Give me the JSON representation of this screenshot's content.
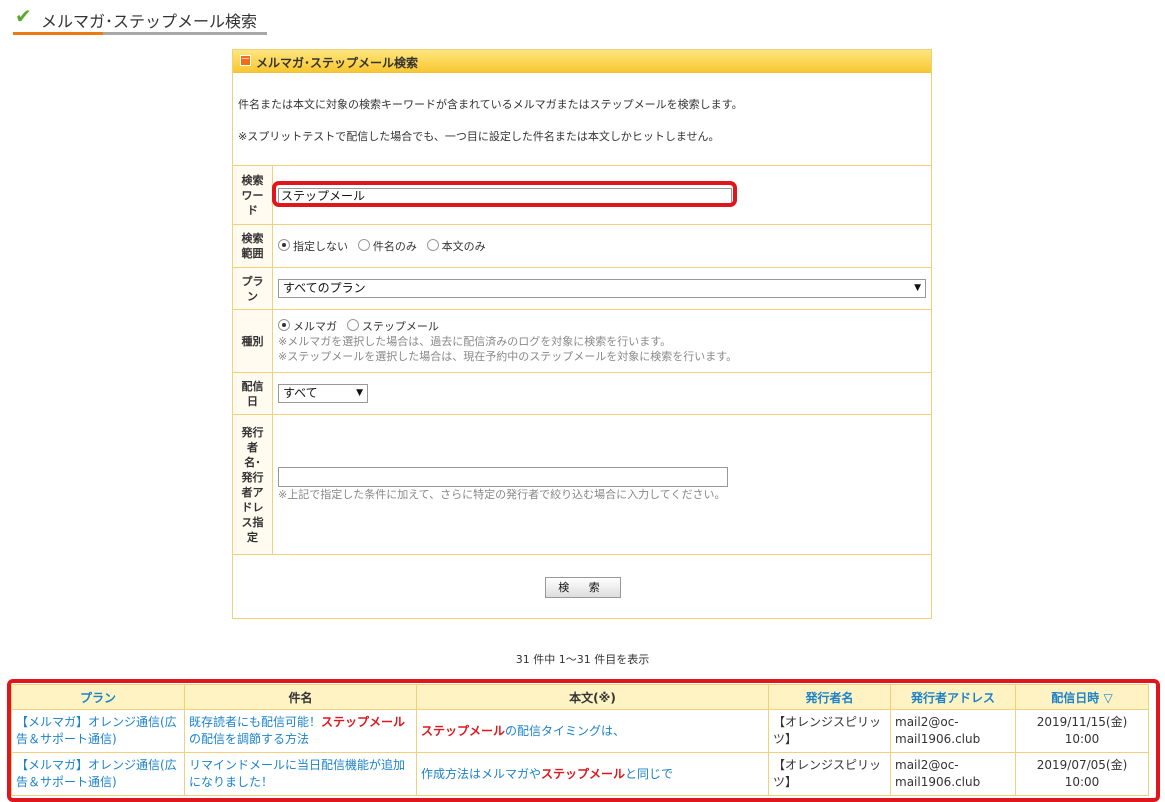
{
  "page": {
    "title": "メルマガ･ステップメール検索"
  },
  "search_box": {
    "header": "メルマガ･ステップメール検索",
    "desc1": "件名または本文に対象の検索キーワードが含まれているメルマガまたはステップメールを検索します。",
    "desc2": "※スプリットテストで配信した場合でも、一つ目に設定した件名または本文しかヒットしません。",
    "keyword": {
      "label": "検索ワード",
      "value": "ステップメール"
    },
    "scope": {
      "label": "検索範囲",
      "options": [
        "指定しない",
        "件名のみ",
        "本文のみ"
      ],
      "selected": "指定しない"
    },
    "plan": {
      "label": "プラン",
      "value": "すべてのプラン"
    },
    "kind": {
      "label": "種別",
      "options": [
        "メルマガ",
        "ステップメール"
      ],
      "selected": "メルマガ",
      "note1": "※メルマガを選択した場合は、過去に配信済みのログを対象に検索を行います。",
      "note2": "※ステップメールを選択した場合は、現在予約中のステップメールを対象に検索を行います。"
    },
    "date": {
      "label": "配信日",
      "value": "すべて"
    },
    "sender": {
      "label": "発行者名･発行者アドレス指定",
      "value": "",
      "note": "※上記で指定した条件に加えて、さらに特定の発行者で絞り込む場合に入力してください。"
    },
    "search_button": "検 索"
  },
  "results": {
    "count_text": "31 件中 1～31 件目を表示",
    "headers": [
      "プラン",
      "件名",
      "本文(※)",
      "発行者名",
      "発行者アドレス",
      "配信日時 ▽"
    ],
    "rows": [
      {
        "plan": "【メルマガ】オレンジ通信(広告＆サポート通信)",
        "subject_pre": "既存読者にも配信可能！",
        "subject_hl": "ステップメール",
        "subject_post": "の配信を調節する方法",
        "body_pre": "",
        "body_hl": "ステップメール",
        "body_post": "の配信タイミングは、",
        "sender": "【オレンジスピリッツ】",
        "address": "mail2@oc-mail1906.club",
        "date": "2019/11/15(金)",
        "time": "10:00"
      },
      {
        "plan": "【メルマガ】オレンジ通信(広告＆サポート通信)",
        "subject_pre": "リマインドメールに当日配信機能が追加になりました！",
        "subject_hl": "",
        "subject_post": "",
        "body_pre": "作成方法はメルマガや",
        "body_hl": "ステップメール",
        "body_post": "と同じで",
        "sender": "【オレンジスピリッツ】",
        "address": "mail2@oc-mail1906.club",
        "date": "2019/07/05(金)",
        "time": "10:00"
      }
    ]
  },
  "colors": {
    "accent_orange": "#f07a12",
    "highlight_red": "#e0161d",
    "link_blue": "#1c83c9",
    "header_yellow": "#f8c730"
  }
}
